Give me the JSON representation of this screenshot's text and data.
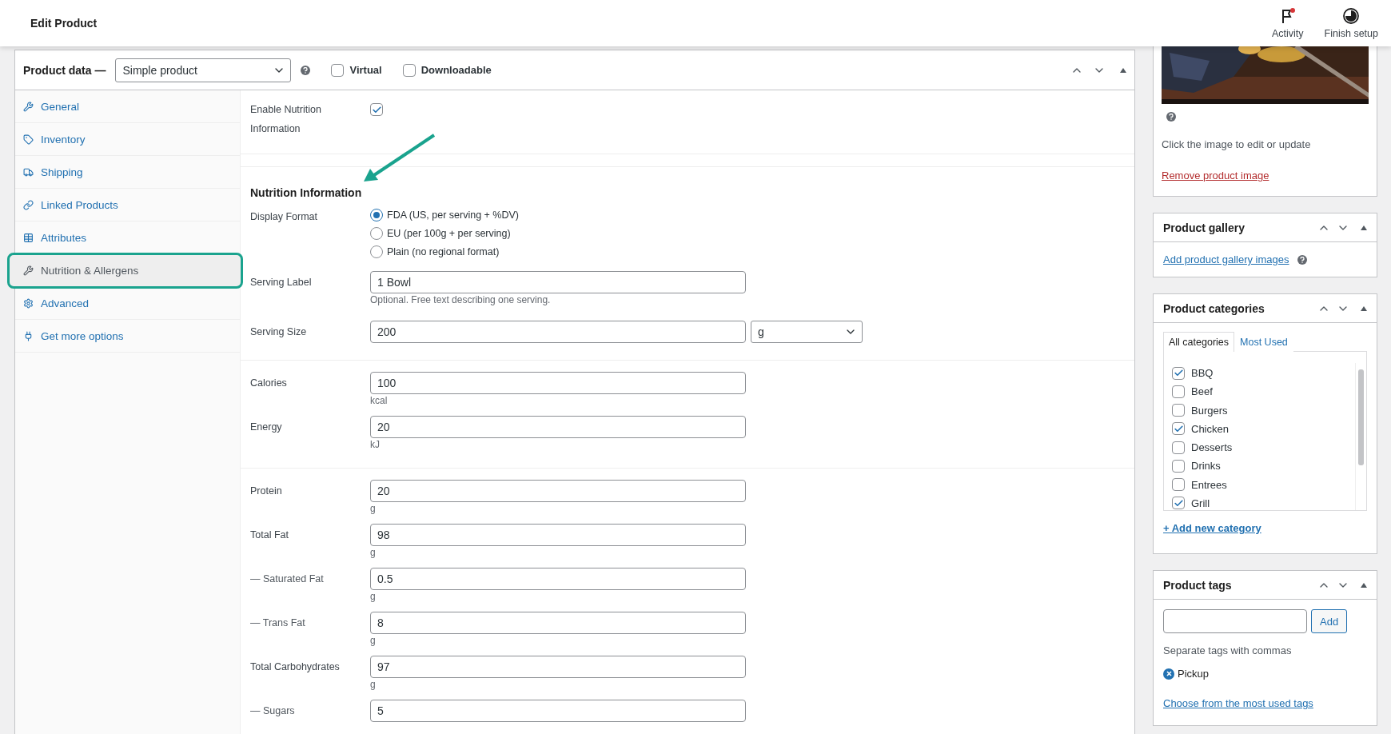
{
  "header": {
    "title": "Edit Product",
    "actions": [
      {
        "label": "Activity",
        "kind": "flag"
      },
      {
        "label": "Finish setup",
        "kind": "progress"
      }
    ]
  },
  "product_data": {
    "title": "Product data —",
    "type_select": "Simple product",
    "options": [
      {
        "label": "Virtual",
        "checked": false
      },
      {
        "label": "Downloadable",
        "checked": false
      }
    ]
  },
  "tabs": [
    {
      "label": "General",
      "selected": false,
      "highlighted": false
    },
    {
      "label": "Inventory",
      "selected": false,
      "highlighted": false
    },
    {
      "label": "Shipping",
      "selected": false,
      "highlighted": false
    },
    {
      "label": "Linked Products",
      "selected": false,
      "highlighted": false
    },
    {
      "label": "Attributes",
      "selected": false,
      "highlighted": false
    },
    {
      "label": "Nutrition & Allergens",
      "selected": true,
      "highlighted": true
    },
    {
      "label": "Advanced",
      "selected": false,
      "highlighted": false
    },
    {
      "label": "Get more options",
      "selected": false,
      "highlighted": false
    }
  ],
  "enable": {
    "label": "Enable Nutrition Information",
    "checked": true
  },
  "nutrition": {
    "heading": "Nutrition Information",
    "display_format": {
      "label": "Display Format",
      "options": [
        {
          "label": "FDA (US, per serving + %DV)",
          "selected": true
        },
        {
          "label": "EU (per 100g + per serving)",
          "selected": false
        },
        {
          "label": "Plain (no regional format)",
          "selected": false
        }
      ]
    },
    "serving_label": {
      "label": "Serving Label",
      "value": "1 Bowl",
      "hint": "Optional. Free text describing one serving."
    },
    "serving_size": {
      "label": "Serving Size",
      "value": "200",
      "unit": "g"
    }
  },
  "energy_fields": [
    {
      "label": "Calories",
      "value": "100",
      "unit": "kcal"
    },
    {
      "label": "Energy",
      "value": "20",
      "unit": "kJ"
    }
  ],
  "nutrient_fields": [
    {
      "label": "Protein",
      "value": "20",
      "unit": "g",
      "kind": "main"
    },
    {
      "label": "Total Fat",
      "value": "98",
      "unit": "g",
      "kind": "main"
    },
    {
      "label": "— Saturated Fat",
      "value": "0.5",
      "unit": "g",
      "kind": "sub"
    },
    {
      "label": "— Trans Fat",
      "value": "8",
      "unit": "g",
      "kind": "sub"
    },
    {
      "label": "Total Carbohydrates",
      "value": "97",
      "unit": "g",
      "kind": "main"
    },
    {
      "label": "— Sugars",
      "value": "5",
      "kind": "sub"
    }
  ],
  "image_panel": {
    "caption": "Click the image to edit or update",
    "remove_link": "Remove product image"
  },
  "gallery": {
    "title": "Product gallery",
    "link": "Add product gallery images"
  },
  "categories": {
    "title": "Product categories",
    "tabs": [
      {
        "label": "All categories",
        "selected": true
      },
      {
        "label": "Most Used",
        "selected": false
      }
    ],
    "items": [
      {
        "label": "BBQ",
        "checked": true
      },
      {
        "label": "Beef",
        "checked": false
      },
      {
        "label": "Burgers",
        "checked": false
      },
      {
        "label": "Chicken",
        "checked": true
      },
      {
        "label": "Desserts",
        "checked": false
      },
      {
        "label": "Drinks",
        "checked": false
      },
      {
        "label": "Entrees",
        "checked": false
      },
      {
        "label": "Grill",
        "checked": true
      }
    ],
    "add_link": "+ Add new category"
  },
  "tags": {
    "title": "Product tags",
    "button": "Add",
    "hint": "Separate tags with commas",
    "tags": [
      "Pickup"
    ],
    "link": "Choose from the most used tags"
  }
}
